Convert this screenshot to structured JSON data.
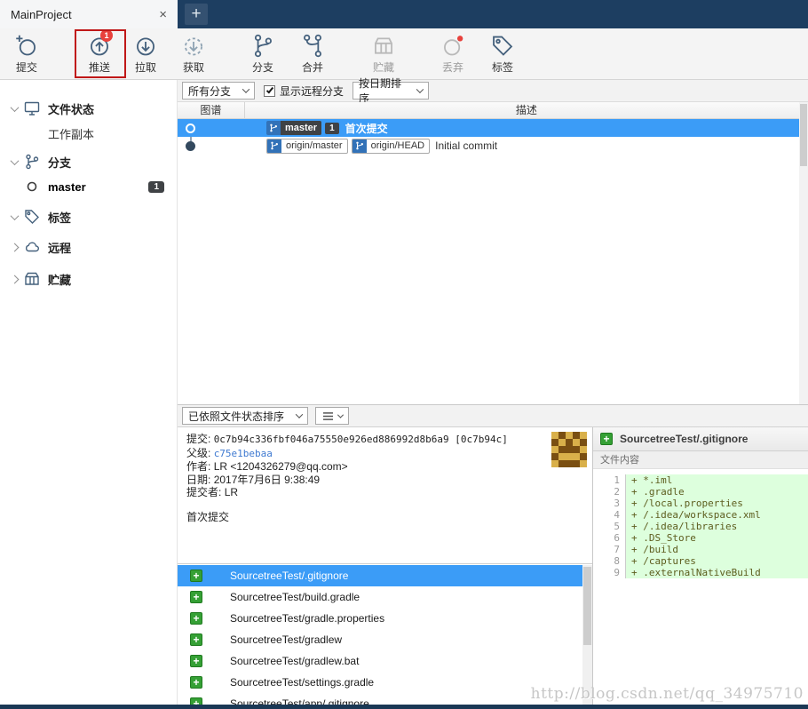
{
  "colors": {
    "titlebar": "#1d3e61",
    "selection_blue": "#3b9cf7",
    "badge_red": "#e8413c",
    "added_green": "#35a035",
    "diff_added_bg": "#ddffdd",
    "link_blue": "#3f7ad1",
    "annotation_red": "#c01818"
  },
  "window": {
    "tab_title": "MainProject",
    "close_glyph": "×",
    "new_tab_glyph": "+"
  },
  "toolbar": {
    "buttons": [
      {
        "label": "提交"
      },
      {
        "label": "推送",
        "badge": "1"
      },
      {
        "label": "拉取"
      },
      {
        "label": "获取"
      },
      {
        "label": "分支"
      },
      {
        "label": "合并"
      },
      {
        "label": "贮藏"
      },
      {
        "label": "丢弃"
      },
      {
        "label": "标签"
      }
    ]
  },
  "sidebar": {
    "items": [
      {
        "label": "文件状态",
        "type": "section",
        "expanded": true
      },
      {
        "label": "工作副本",
        "type": "child"
      },
      {
        "label": "分支",
        "type": "section",
        "expanded": true
      },
      {
        "label": "master",
        "type": "child",
        "badge": "1",
        "current": true
      },
      {
        "label": "标签",
        "type": "section",
        "expanded": true
      },
      {
        "label": "远程",
        "type": "section",
        "expanded": false
      },
      {
        "label": "贮藏",
        "type": "section",
        "expanded": false
      }
    ]
  },
  "filter_bar": {
    "branch_filter_value": "所有分支",
    "show_remote_label": "显示远程分支",
    "show_remote_checked": true,
    "sort_value": "按日期排序"
  },
  "history": {
    "columns": {
      "graph": "图谱",
      "description": "描述"
    },
    "rows": [
      {
        "refs": [
          "master"
        ],
        "ahead_badge": "1",
        "message": "首次提交",
        "selected": true
      },
      {
        "refs": [
          "origin/master",
          "origin/HEAD"
        ],
        "message": "Initial commit",
        "selected": false
      }
    ]
  },
  "detail": {
    "sort_dropdown_value": "已依照文件状态排序",
    "commit": {
      "labels": {
        "commit": "提交:",
        "parent": "父级:",
        "author": "作者:",
        "date": "日期:",
        "committer": "提交者:"
      },
      "hash": "0c7b94c336fbf046a75550e926ed886992d8b6a9 [0c7b94c]",
      "parent": "c75e1bebaa",
      "author": "LR <1204326279@qq.com>",
      "date": "2017年7月6日 9:38:49",
      "committer": "LR",
      "message": "首次提交"
    },
    "files": [
      "SourcetreeTest/.gitignore",
      "SourcetreeTest/build.gradle",
      "SourcetreeTest/gradle.properties",
      "SourcetreeTest/gradlew",
      "SourcetreeTest/gradlew.bat",
      "SourcetreeTest/settings.gradle",
      "SourcetreeTest/app/.gitignore"
    ]
  },
  "diff": {
    "file_title": "SourcetreeTest/.gitignore",
    "section_label": "文件内容",
    "lines": [
      {
        "num": "1",
        "text": "+ *.iml"
      },
      {
        "num": "2",
        "text": "+ .gradle"
      },
      {
        "num": "3",
        "text": "+ /local.properties"
      },
      {
        "num": "4",
        "text": "+ /.idea/workspace.xml"
      },
      {
        "num": "5",
        "text": "+ /.idea/libraries"
      },
      {
        "num": "6",
        "text": "+ .DS_Store"
      },
      {
        "num": "7",
        "text": "+ /build"
      },
      {
        "num": "8",
        "text": "+ /captures"
      },
      {
        "num": "9",
        "text": "+ .externalNativeBuild"
      }
    ]
  },
  "watermark": "http://blog.csdn.net/qq_34975710"
}
